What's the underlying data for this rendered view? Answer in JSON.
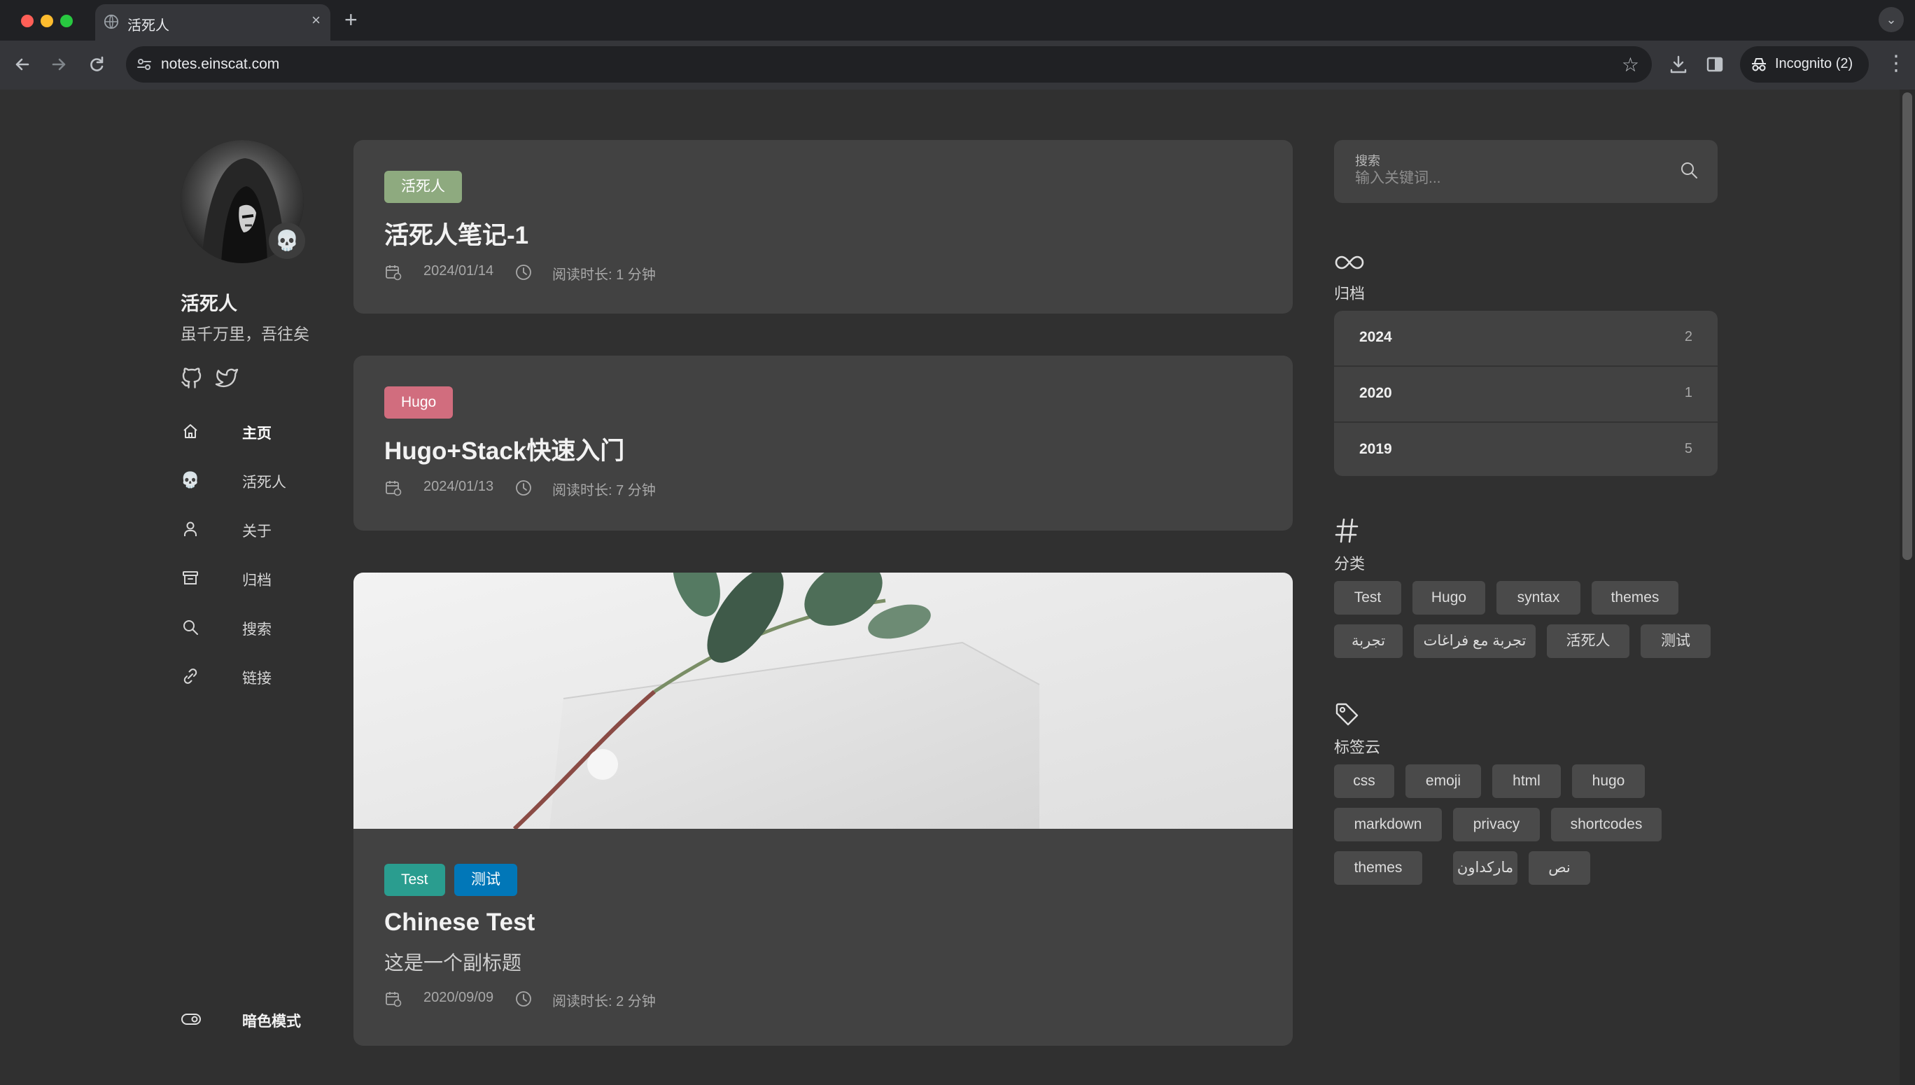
{
  "browser": {
    "tab_title": "活死人",
    "tab_close": "×",
    "new_tab": "+",
    "url": "notes.einscat.com",
    "incognito_label": "Incognito (2)"
  },
  "sidebar": {
    "site_name": "活死人",
    "site_description": "虽千万里，吾往矣",
    "avatar_emoji": "💀",
    "social_icons": [
      "github-icon",
      "twitter-icon"
    ],
    "menu": [
      {
        "label": "主页",
        "icon": "home-icon",
        "active": true
      },
      {
        "label": "活死人",
        "icon": "skull-emoji-icon",
        "active": false
      },
      {
        "label": "关于",
        "icon": "user-icon",
        "active": false
      },
      {
        "label": "归档",
        "icon": "archive-icon",
        "active": false
      },
      {
        "label": "搜索",
        "icon": "search-icon",
        "active": false
      },
      {
        "label": "链接",
        "icon": "link-icon",
        "active": false
      }
    ],
    "dark_mode_label": "暗色模式"
  },
  "articles": [
    {
      "categories": [
        {
          "name": "活死人",
          "color": "#8eaa7f"
        }
      ],
      "title": "活死人笔记-1",
      "date": "2024/01/14",
      "reading_time": "阅读时长: 1 分钟"
    },
    {
      "categories": [
        {
          "name": "Hugo",
          "color": "#d16d7e"
        }
      ],
      "title": "Hugo+Stack快速入门",
      "date": "2024/01/13",
      "reading_time": "阅读时长: 7 分钟"
    },
    {
      "categories": [
        {
          "name": "Test",
          "color": "#2a9d8f"
        },
        {
          "name": "测试",
          "color": "#0177b8"
        }
      ],
      "title": "Chinese Test",
      "subtitle": "这是一个副标题",
      "date": "2020/09/09",
      "reading_time": "阅读时长: 2 分钟",
      "has_image": true
    }
  ],
  "search": {
    "label": "搜索",
    "placeholder": "输入关键词..."
  },
  "archives": {
    "title": "归档",
    "years": [
      {
        "year": "2024",
        "count": "2"
      },
      {
        "year": "2020",
        "count": "1"
      },
      {
        "year": "2019",
        "count": "5"
      }
    ]
  },
  "categories_widget": {
    "title": "分类",
    "items": [
      "Test",
      "Hugo",
      "syntax",
      "themes",
      "تجربة",
      "تجربة مع فراغات",
      "活死人",
      "测试"
    ]
  },
  "tag_cloud": {
    "title": "标签云",
    "items": [
      "css",
      "emoji",
      "html",
      "hugo",
      "markdown",
      "privacy",
      "shortcodes",
      "themes",
      "ماركداون",
      "نص"
    ]
  },
  "colors": {
    "page_bg": "#303030",
    "card_bg": "#424242",
    "tag_bg": "#4a4a4a"
  }
}
